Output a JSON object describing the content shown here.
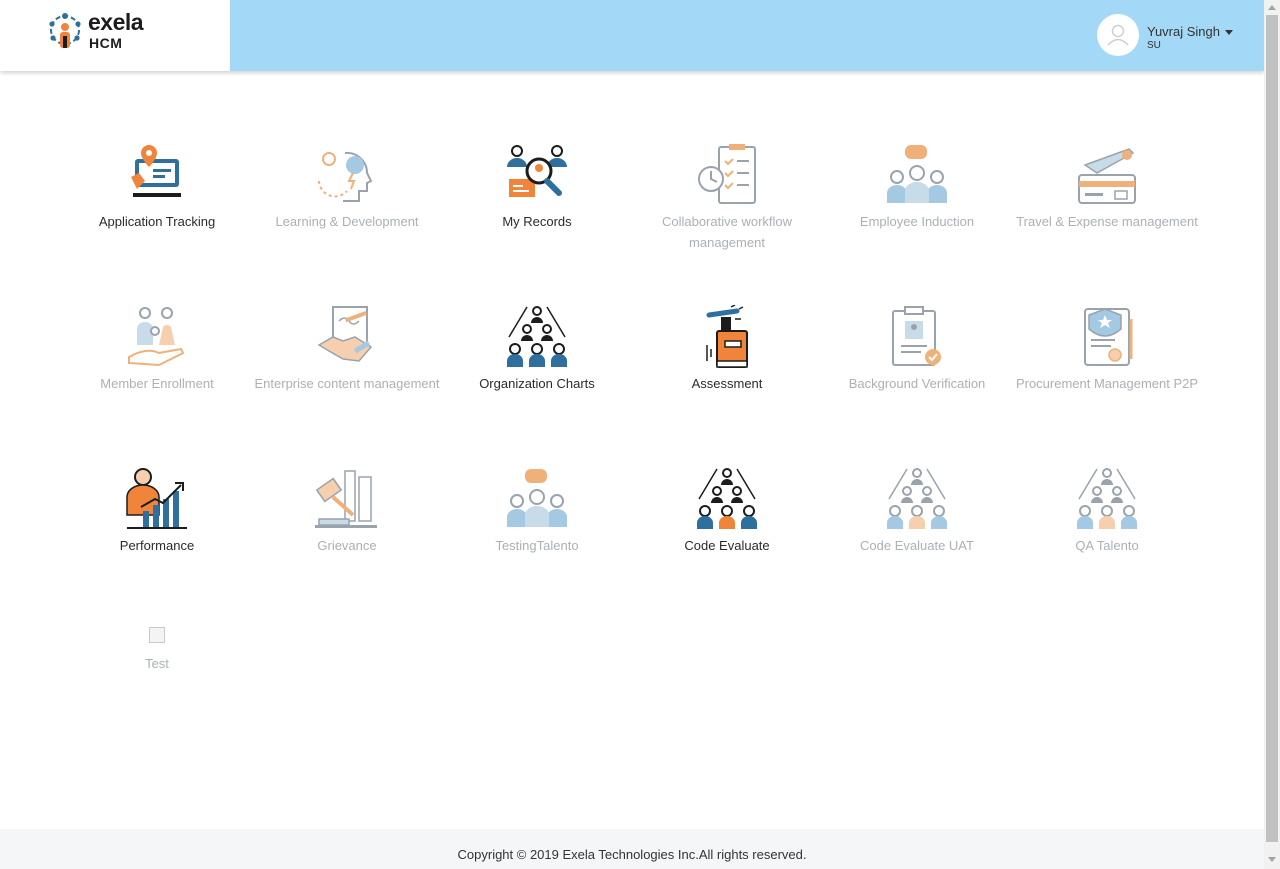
{
  "brand": {
    "name": "exela",
    "sub": "HCM",
    "colors": {
      "header_bg": "#a3d9f7",
      "accent_orange": "#f0843a",
      "accent_blue": "#2e6f9e",
      "muted_label": "#aab0b6"
    }
  },
  "user": {
    "name": "Yuvraj Singh",
    "role": "SU",
    "avatar_icon": "user-avatar-icon"
  },
  "apps": [
    {
      "label": "Application Tracking",
      "icon": "location-pin-icon",
      "active": true
    },
    {
      "label": "Learning & Development",
      "icon": "idea-head-icon",
      "active": false
    },
    {
      "label": "My Records",
      "icon": "search-people-icon",
      "active": true
    },
    {
      "label": "Collaborative workflow management",
      "icon": "checklist-icon",
      "active": false
    },
    {
      "label": "Employee Induction",
      "icon": "group-chat-icon",
      "active": false
    },
    {
      "label": "Travel & Expense management",
      "icon": "plane-card-icon",
      "active": false
    },
    {
      "label": "Member Enrollment",
      "icon": "family-icon",
      "active": false
    },
    {
      "label": "Enterprise content management",
      "icon": "handshake-icon",
      "active": false
    },
    {
      "label": "Organization Charts",
      "icon": "org-chart-icon",
      "active": true
    },
    {
      "label": "Assessment",
      "icon": "book-pen-icon",
      "active": true
    },
    {
      "label": "Background Verification",
      "icon": "id-clipboard-icon",
      "active": false
    },
    {
      "label": "Procurement Management P2P",
      "icon": "scroll-badge-icon",
      "active": false
    },
    {
      "label": "Performance",
      "icon": "growth-chart-icon",
      "active": true
    },
    {
      "label": "Grievance",
      "icon": "gavel-icon",
      "active": false
    },
    {
      "label": "TestingTalento",
      "icon": "group-chat-icon",
      "active": false
    },
    {
      "label": "Code Evaluate",
      "icon": "org-chart-icon",
      "active": true
    },
    {
      "label": "Code Evaluate UAT",
      "icon": "org-chart-icon",
      "active": false
    },
    {
      "label": "QA Talento",
      "icon": "org-chart-icon",
      "active": false
    },
    {
      "label": "Test",
      "icon": "broken-image-icon",
      "active": false
    }
  ],
  "footer": {
    "copyright": "Copyright © 2019 Exela Technologies Inc.All rights reserved."
  }
}
